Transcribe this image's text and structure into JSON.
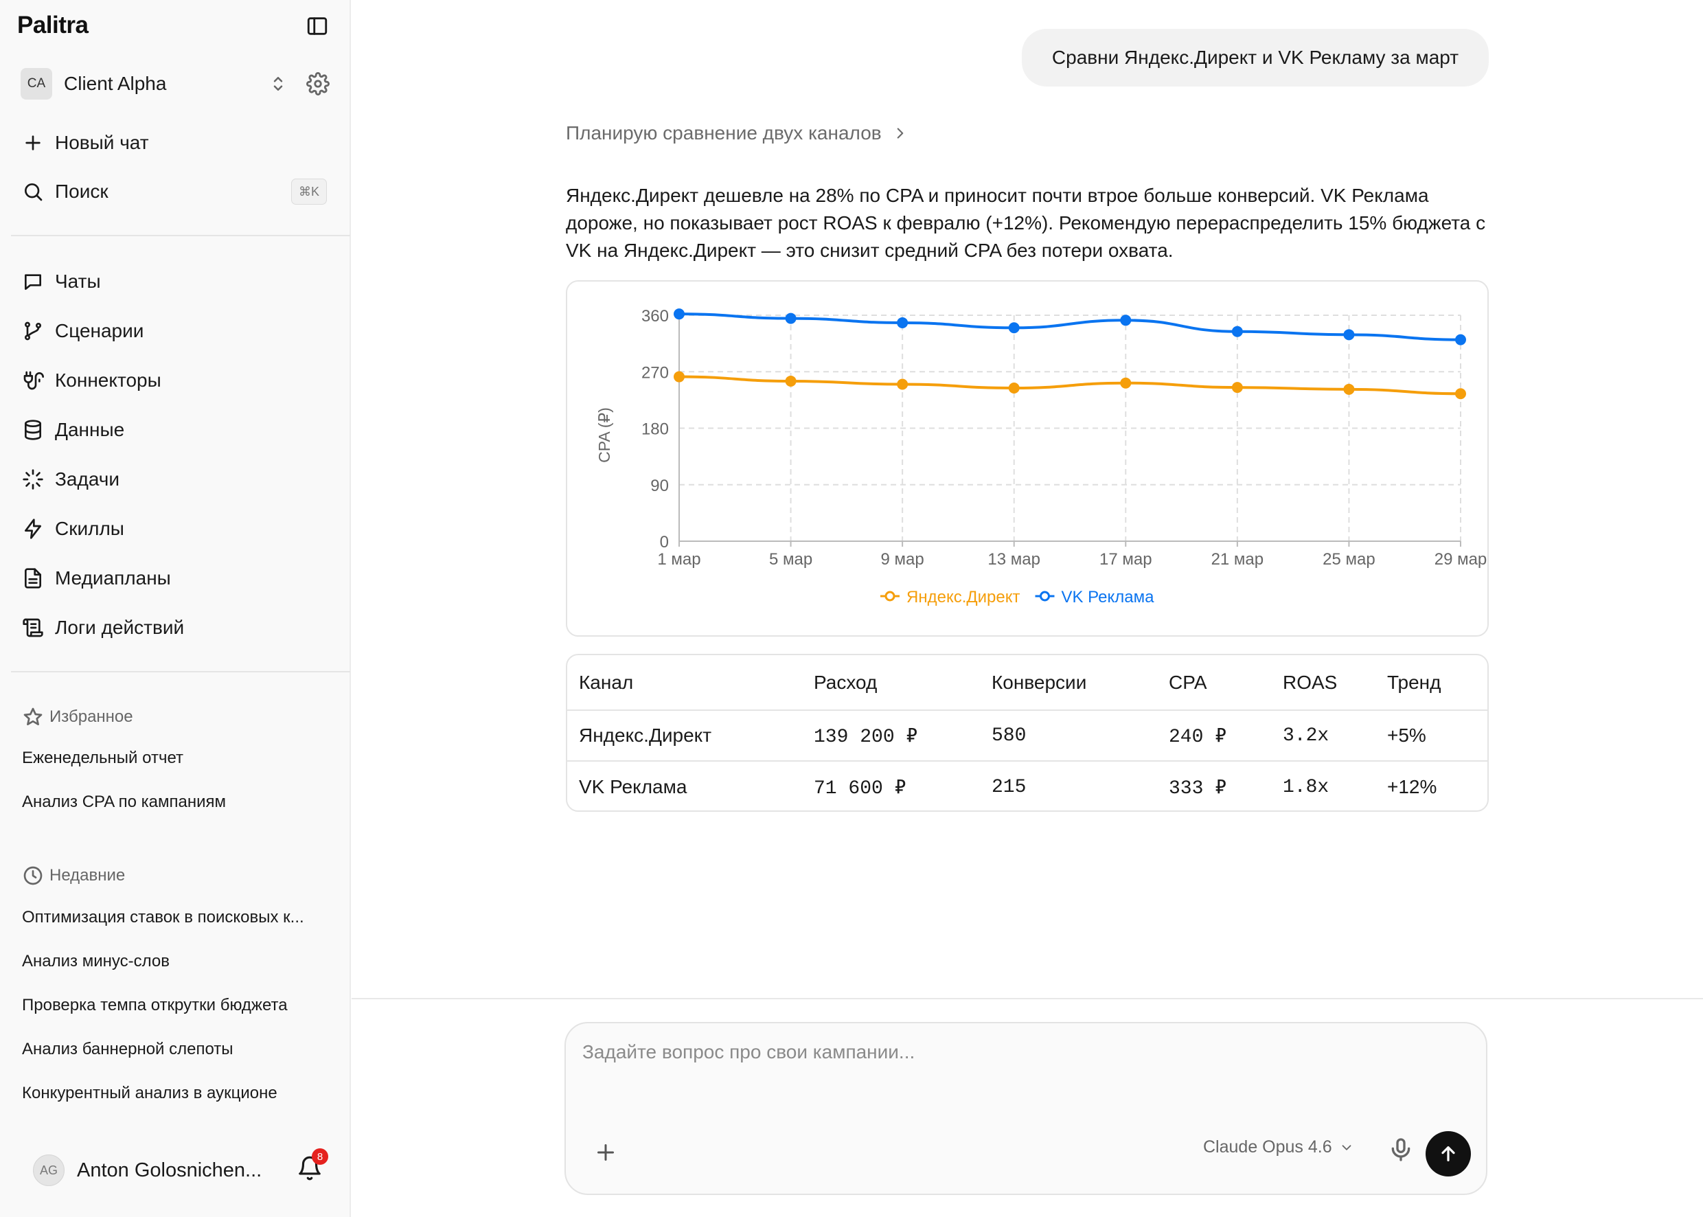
{
  "sidebar": {
    "brand": "Palitra",
    "client": {
      "initials": "CA",
      "name": "Client Alpha"
    },
    "new_chat": "Новый чат",
    "search": "Поиск",
    "search_shortcut": "⌘K",
    "nav": [
      {
        "label": "Чаты",
        "icon": "chat-icon"
      },
      {
        "label": "Сценарии",
        "icon": "branch-icon"
      },
      {
        "label": "Коннекторы",
        "icon": "plug-icon"
      },
      {
        "label": "Данные",
        "icon": "database-icon"
      },
      {
        "label": "Задачи",
        "icon": "loader-icon"
      },
      {
        "label": "Скиллы",
        "icon": "bolt-icon"
      },
      {
        "label": "Медиапланы",
        "icon": "document-icon"
      },
      {
        "label": "Логи действий",
        "icon": "scroll-icon"
      }
    ],
    "favorites_title": "Избранное",
    "favorites": [
      "Еженедельный отчет",
      "Анализ CPA по кампаниям"
    ],
    "recent_title": "Недавние",
    "recent": [
      "Оптимизация ставок в поисковых к...",
      "Анализ минус-слов",
      "Проверка темпа открутки бюджета",
      "Анализ баннерной слепоты",
      "Конкурентный анализ в аукционе"
    ],
    "user": {
      "initials": "AG",
      "name": "Anton Golosnichen...",
      "notifications": "8"
    }
  },
  "chat": {
    "user_message": "Сравни Яндекс.Директ и VK Рекламу за март",
    "thinking_label": "Планирую сравнение двух каналов",
    "answer": "Яндекс.Директ дешевле на 28% по CPA и приносит почти втрое больше конверсий. VK Реклама дороже, но показывает рост ROAS к февралю (+12%). Рекомендую перераспределить 15% бюджета с VK на Яндекс.Директ — это снизит средний CPA без потери охвата."
  },
  "chart_data": {
    "type": "line",
    "x": [
      "1 мар",
      "5 мар",
      "9 мар",
      "13 мар",
      "17 мар",
      "21 мар",
      "25 мар",
      "29 мар"
    ],
    "ylabel": "CPA (₽)",
    "ylim": [
      0,
      360
    ],
    "yticks": [
      0,
      90,
      180,
      270,
      360
    ],
    "grid": true,
    "legend": "bottom",
    "series": [
      {
        "name": "Яндекс.Директ",
        "color": "#f59e0b",
        "values": [
          262,
          255,
          250,
          244,
          252,
          245,
          242,
          235
        ]
      },
      {
        "name": "VK Реклама",
        "color": "#0a74f0",
        "values": [
          362,
          355,
          348,
          340,
          352,
          334,
          329,
          321
        ]
      }
    ]
  },
  "table": {
    "headers": [
      "Канал",
      "Расход",
      "Конверсии",
      "CPA",
      "ROAS",
      "Тренд"
    ],
    "rows": [
      [
        "Яндекс.Директ",
        "139 200 ₽",
        "580",
        "240 ₽",
        "3.2x",
        "+5%"
      ],
      [
        "VK Реклама",
        "71 600 ₽",
        "215",
        "333 ₽",
        "1.8x",
        "+12%"
      ]
    ]
  },
  "composer": {
    "placeholder": "Задайте вопрос про свои кампании...",
    "model": "Claude Opus 4.6"
  }
}
